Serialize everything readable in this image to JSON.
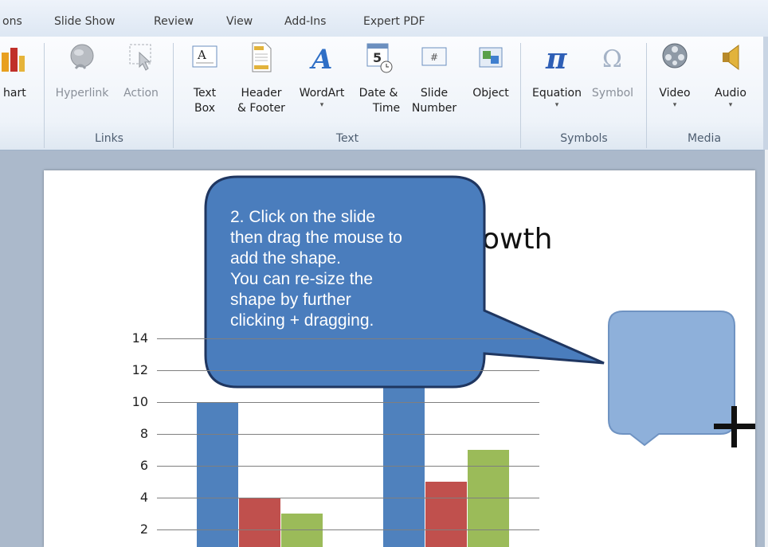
{
  "tabs": [
    "ons",
    "Slide Show",
    "Review",
    "View",
    "Add-Ins",
    "Expert PDF"
  ],
  "ribbon": {
    "buttons": {
      "chart": "hart",
      "hyperlink": "Hyperlink",
      "action": "Action",
      "textbox_1": "Text",
      "textbox_2": "Box",
      "header_1": "Header",
      "header_2": "& Footer",
      "wordart": "WordArt",
      "datetime_1": "Date &",
      "datetime_2": "Time",
      "slidenum_1": "Slide",
      "slidenum_2": "Number",
      "object": "Object",
      "equation": "Equation",
      "symbol": "Symbol",
      "video": "Video",
      "audio": "Audio"
    },
    "groups": {
      "links": "Links",
      "text": "Text",
      "symbols": "Symbols",
      "media": "Media"
    },
    "glyphs": {
      "pi": "π",
      "omega": "Ω",
      "wordart": "A",
      "date_num": "5",
      "slide_num": "#",
      "textbox": "A"
    }
  },
  "slide": {
    "title_partial": "owth",
    "callout_lines": [
      "2.  Click  on  the  slide",
      "then drag the mouse to",
      "add the shape.",
      "You can re-size the",
      "shape by further",
      "clicking + dragging."
    ],
    "cursor": "+"
  },
  "chart_data": {
    "type": "bar",
    "y_ticks": [
      "14",
      "12",
      "10",
      "8",
      "6",
      "4",
      "2"
    ],
    "ylim": [
      0,
      14
    ],
    "series_colors": [
      "#4f81bd",
      "#c0504d",
      "#9bbb59"
    ],
    "visible_values": [
      [
        10,
        4,
        3
      ],
      [
        null,
        5,
        7
      ]
    ]
  },
  "colors": {
    "callout_fill": "#4a7dbd",
    "callout_border": "#1f3660",
    "shape_fill": "#8eb0da",
    "shape_border": "#6f93c2"
  }
}
